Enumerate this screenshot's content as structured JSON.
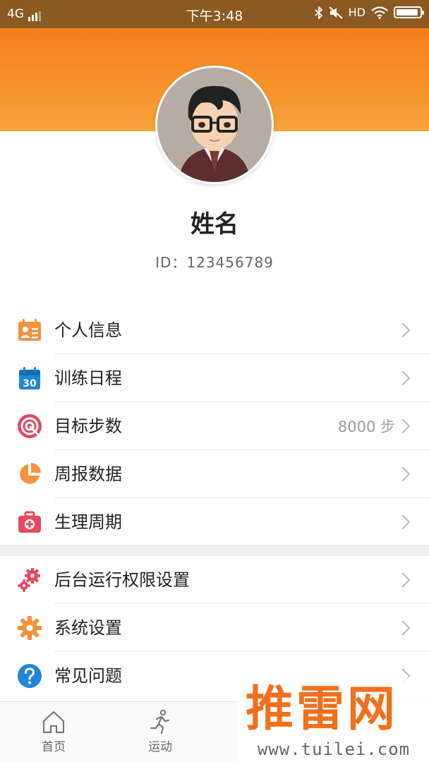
{
  "status_bar": {
    "network": "4G",
    "time": "下午3:48",
    "hd": "HD",
    "battery_level": 0.95
  },
  "profile": {
    "name": "姓名",
    "id": "ID：123456789"
  },
  "menu_group_1": {
    "items": [
      {
        "label": "个人信息",
        "icon": "profile-card-icon",
        "value": ""
      },
      {
        "label": "训练日程",
        "icon": "calendar-icon",
        "value": ""
      },
      {
        "label": "目标步数",
        "icon": "target-icon",
        "value": "8000 步"
      },
      {
        "label": "周报数据",
        "icon": "pie-chart-icon",
        "value": ""
      },
      {
        "label": "生理周期",
        "icon": "medical-kit-icon",
        "value": ""
      }
    ]
  },
  "menu_group_2": {
    "items": [
      {
        "label": "后台运行权限设置",
        "icon": "gears-icon",
        "value": ""
      },
      {
        "label": "系统设置",
        "icon": "gear-icon",
        "value": ""
      },
      {
        "label": "常见问题",
        "icon": "question-icon",
        "value": ""
      }
    ]
  },
  "calendar_icon_day": "30",
  "bottom_nav": {
    "items": [
      {
        "label": "首页",
        "icon": "home-icon"
      },
      {
        "label": "运动",
        "icon": "running-icon"
      }
    ]
  },
  "watermark": {
    "logo": "推雷网",
    "url": "www.tuilei.com"
  },
  "colors": {
    "status_bar": "#8a5a22",
    "header_top": "#f57f1c",
    "header_bottom": "#f8a23a",
    "orange_icon": "#f5923e",
    "blue_icon": "#1f86d9",
    "red_icon": "#e8475f",
    "chevron": "#b8b8b8"
  }
}
